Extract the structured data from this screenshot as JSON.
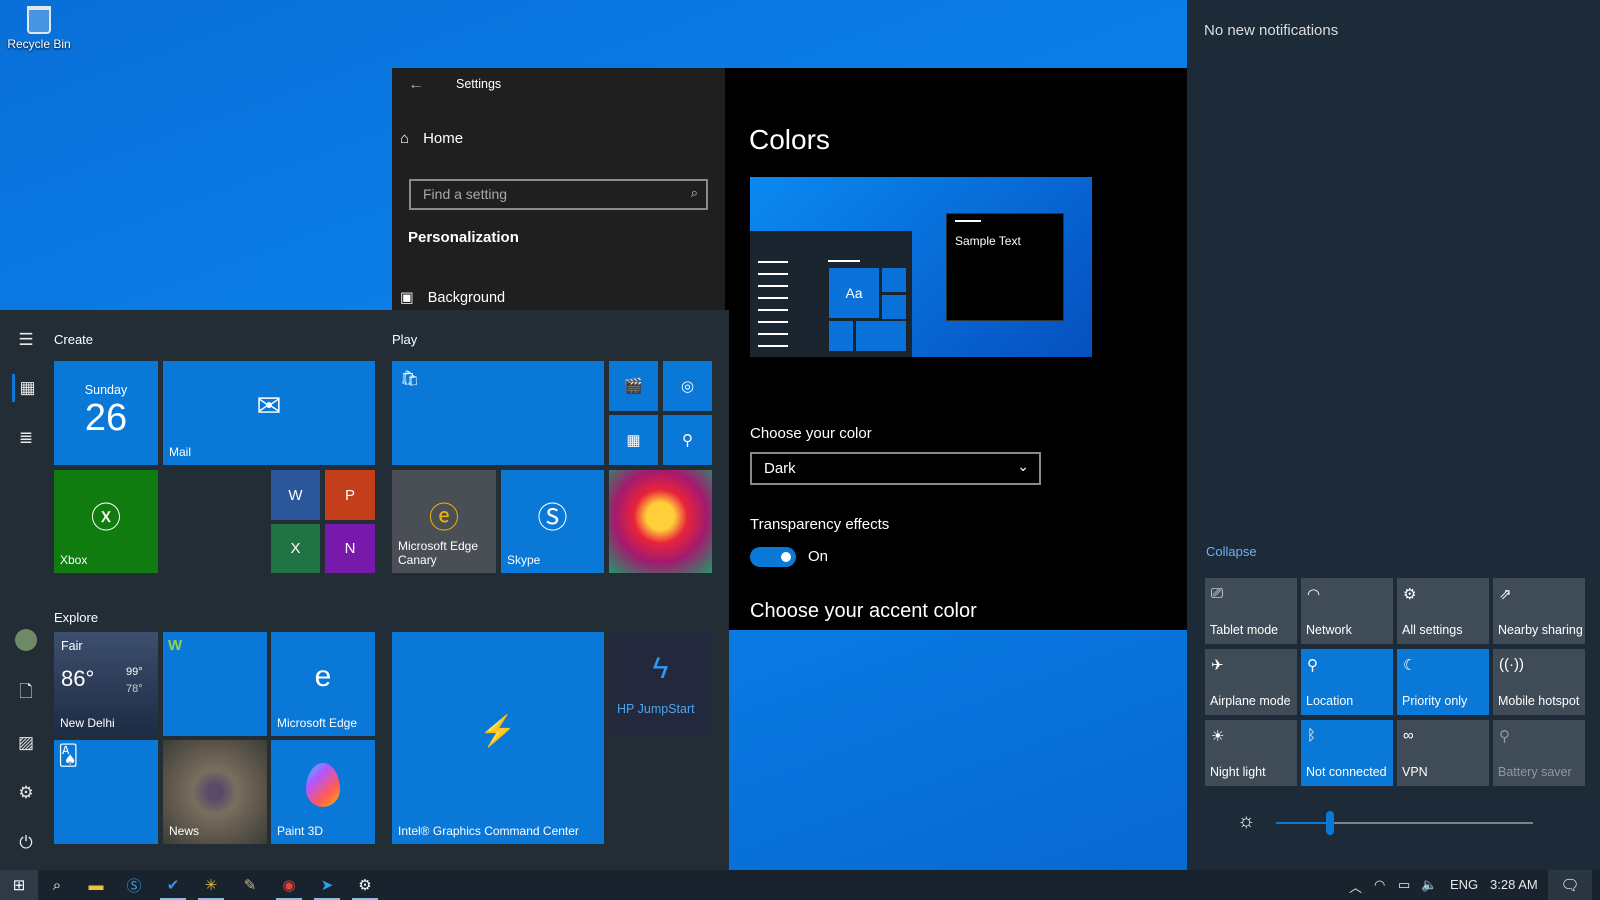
{
  "desktop": {
    "recycle_bin": "Recycle Bin"
  },
  "settings": {
    "title": "Settings",
    "home": "Home",
    "search_placeholder": "Find a setting",
    "section": "Personalization",
    "nav_background": "Background",
    "page_title": "Colors",
    "sample_text": "Sample Text",
    "preview_aa": "Aa",
    "choose_color_label": "Choose your color",
    "choose_color_value": "Dark",
    "transparency_label": "Transparency effects",
    "transparency_value": "On",
    "transparency_on": true,
    "accent_label": "Choose your accent color",
    "accent_color": "#0a78d7"
  },
  "start": {
    "groups": {
      "create": "Create",
      "play": "Play",
      "explore": "Explore"
    },
    "calendar": {
      "day": "Sunday",
      "date": "26"
    },
    "tiles": {
      "mail": "Mail",
      "xbox": "Xbox",
      "word": "W",
      "powerpoint": "P",
      "excel": "X",
      "onenote": "N",
      "edge_canary": "Microsoft Edge Canary",
      "skype": "Skype",
      "edge": "Microsoft Edge",
      "news": "News",
      "paint3d": "Paint 3D",
      "intel": "Intel® Graphics Command Center",
      "hp": "HP JumpStart"
    },
    "weather": {
      "condition": "Fair",
      "temp": "86°",
      "high": "99°",
      "low": "78°",
      "city": "New Delhi"
    }
  },
  "action_center": {
    "no_notifications": "No new notifications",
    "collapse": "Collapse",
    "quick_actions": [
      {
        "label": "Tablet mode",
        "icon": "tablet-mode-icon",
        "glyph": "⎚",
        "active": false
      },
      {
        "label": "Network",
        "icon": "network-icon",
        "glyph": "◠",
        "active": false
      },
      {
        "label": "All settings",
        "icon": "gear-icon",
        "glyph": "⚙",
        "active": false
      },
      {
        "label": "Nearby sharing",
        "icon": "share-icon",
        "glyph": "⇗",
        "active": false
      },
      {
        "label": "Airplane mode",
        "icon": "airplane-icon",
        "glyph": "✈",
        "active": false
      },
      {
        "label": "Location",
        "icon": "location-icon",
        "glyph": "⚲",
        "active": true
      },
      {
        "label": "Priority only",
        "icon": "moon-icon",
        "glyph": "☾",
        "active": true
      },
      {
        "label": "Mobile hotspot",
        "icon": "hotspot-icon",
        "glyph": "((·))",
        "active": false
      },
      {
        "label": "Night light",
        "icon": "night-light-icon",
        "glyph": "☀",
        "active": false
      },
      {
        "label": "Not connected",
        "icon": "bluetooth-icon",
        "glyph": "ᛒ",
        "active": true
      },
      {
        "label": "VPN",
        "icon": "vpn-icon",
        "glyph": "∞",
        "active": false
      },
      {
        "label": "Battery saver",
        "icon": "battery-saver-icon",
        "glyph": "⚲",
        "active": false,
        "disabled": true
      }
    ],
    "brightness_percent": 21
  },
  "taskbar": {
    "apps": [
      "start",
      "search",
      "file-explorer",
      "skype",
      "todo",
      "slack",
      "paint",
      "chrome",
      "telegram",
      "settings"
    ],
    "language": "ENG",
    "time": "3:28 AM"
  }
}
